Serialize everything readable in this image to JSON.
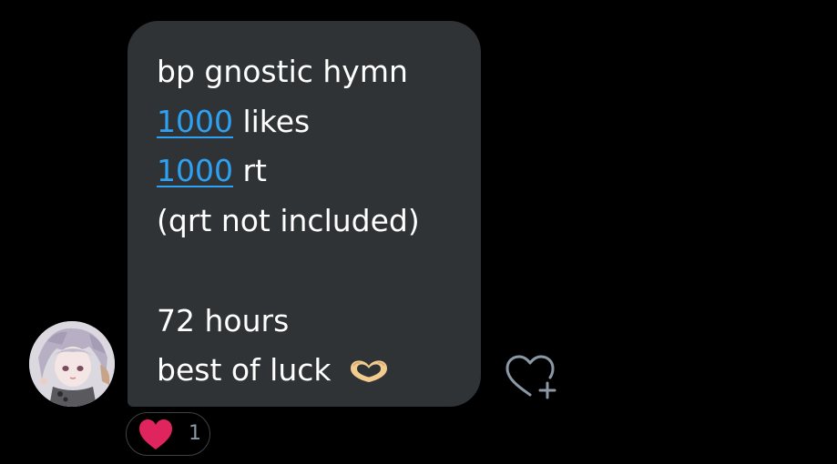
{
  "message": {
    "lines": [
      {
        "text": "bp gnostic hymn"
      },
      {
        "number": "1000",
        "suffix": " likes"
      },
      {
        "number": "1000",
        "suffix": " rt"
      },
      {
        "text": "(qrt not included)"
      },
      {
        "text": ""
      },
      {
        "text": "72 hours"
      },
      {
        "text": "best of luck",
        "emoji": "heart-hands-emoji"
      }
    ]
  },
  "reaction": {
    "emoji": "red-heart-emoji",
    "count": "1"
  },
  "colors": {
    "bubble": "#2f3336",
    "link": "#2ea1f2",
    "heart": "#e0245e"
  }
}
